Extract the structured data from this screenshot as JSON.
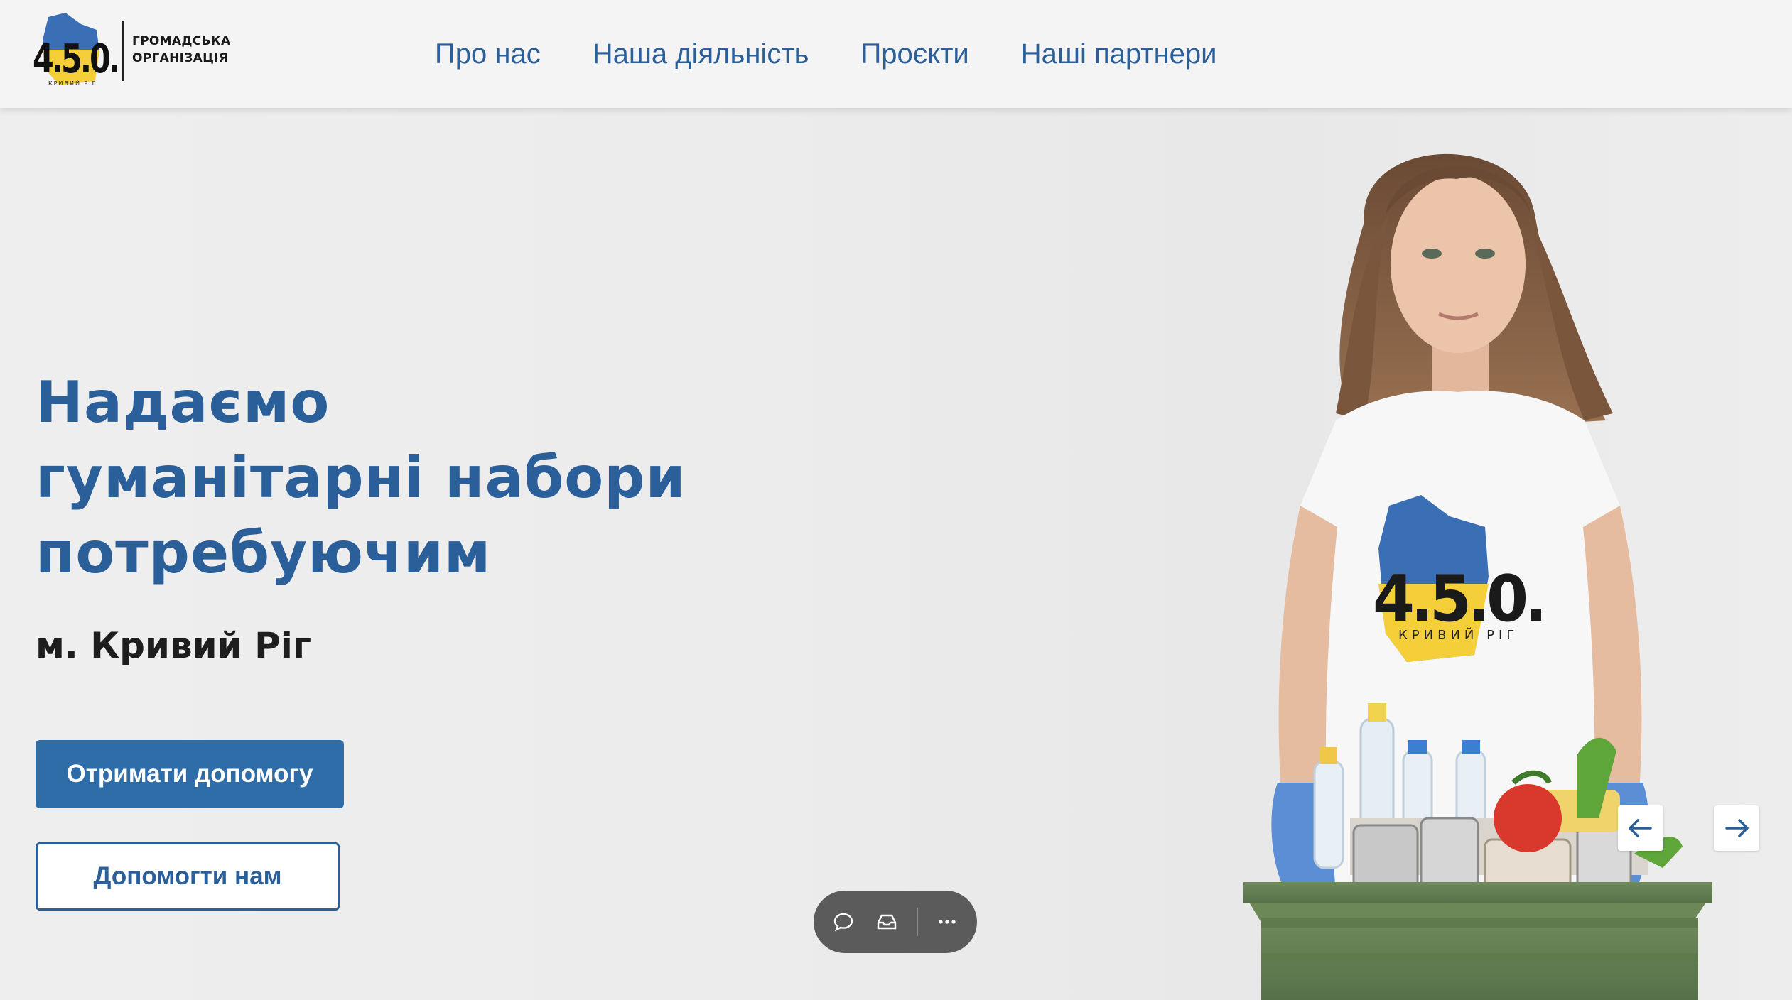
{
  "logo": {
    "mark_text": "4.5.0.",
    "mark_subtext": "КРИВИЙ РІГ",
    "org_line1": "ГРОМАДСЬКА",
    "org_line2": "ОРГАНІЗАЦІЯ"
  },
  "nav": {
    "items": [
      {
        "label": "Про нас"
      },
      {
        "label": "Наша діяльність"
      },
      {
        "label": "Проєкти"
      },
      {
        "label": "Наші партнери"
      }
    ]
  },
  "hero": {
    "title_lines": [
      "Надаємо",
      "гуманітарні набори",
      "потребуючим"
    ],
    "subtitle": "м. Кривий Ріг",
    "primary_button": "Отримати допомогу",
    "secondary_button": "Допомогти нам",
    "shirt_logo_text": "4.5.0.",
    "shirt_logo_subtext": "КРИВИЙ РІГ"
  },
  "colors": {
    "brand_blue": "#2b5f99",
    "button_blue": "#2f6da8",
    "logo_yellow": "#f4cf3a"
  },
  "toolbar": {
    "icons": [
      "chat-bubble-icon",
      "inbox-icon",
      "more-dots-icon"
    ]
  },
  "slider": {
    "icons": [
      "arrow-left-icon",
      "arrow-right-icon"
    ]
  }
}
